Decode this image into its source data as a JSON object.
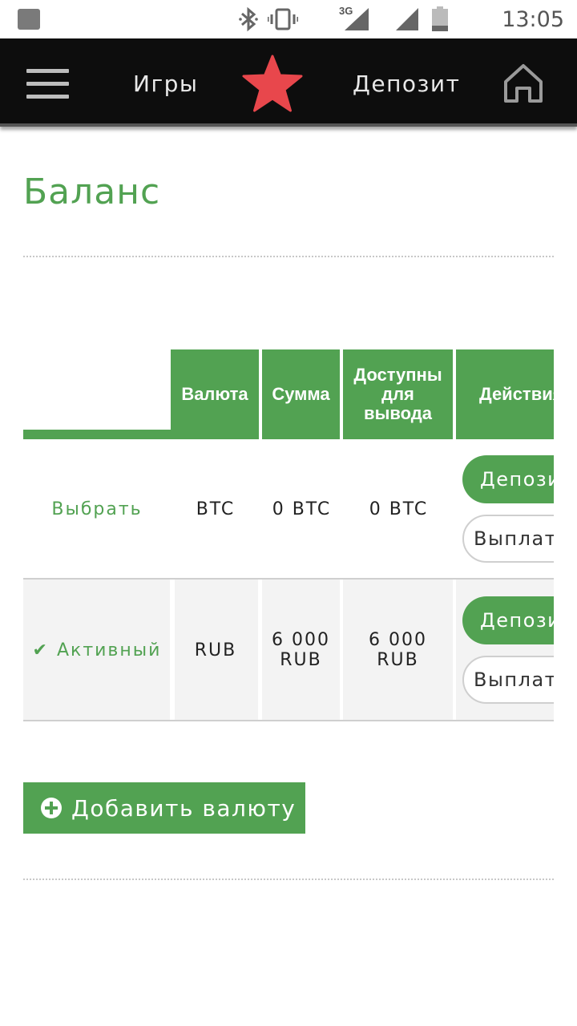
{
  "status_bar": {
    "time": "13:05",
    "network": "3G",
    "icons": [
      "notification-icon",
      "bluetooth-icon",
      "vibrate-icon",
      "signal-3g-icon",
      "signal-icon",
      "battery-icon"
    ]
  },
  "nav": {
    "games": "Игры",
    "deposit": "Депозит",
    "icons": [
      "menu-icon",
      "star-logo-icon",
      "home-icon"
    ]
  },
  "page": {
    "title": "Баланс"
  },
  "table": {
    "headers": {
      "currency": "Валюта",
      "amount": "Сумма",
      "available": "Доступны для вывода",
      "actions": "Действия"
    },
    "rows": [
      {
        "status": "Выбрать",
        "currency": "BTC",
        "amount": "0 BTC",
        "available": "0 BTC",
        "deposit_label": "Депозит",
        "payout_label": "Выплата"
      },
      {
        "status": "Активный",
        "currency": "RUB",
        "amount": "6 000 RUB",
        "available": "6 000 RUB",
        "deposit_label": "Депозит",
        "payout_label": "Выплата"
      }
    ]
  },
  "add_currency": {
    "label": "Добавить валюту"
  },
  "colors": {
    "accent": "#52a252",
    "navbar": "#0d0d0d",
    "star": "#e8474c"
  }
}
